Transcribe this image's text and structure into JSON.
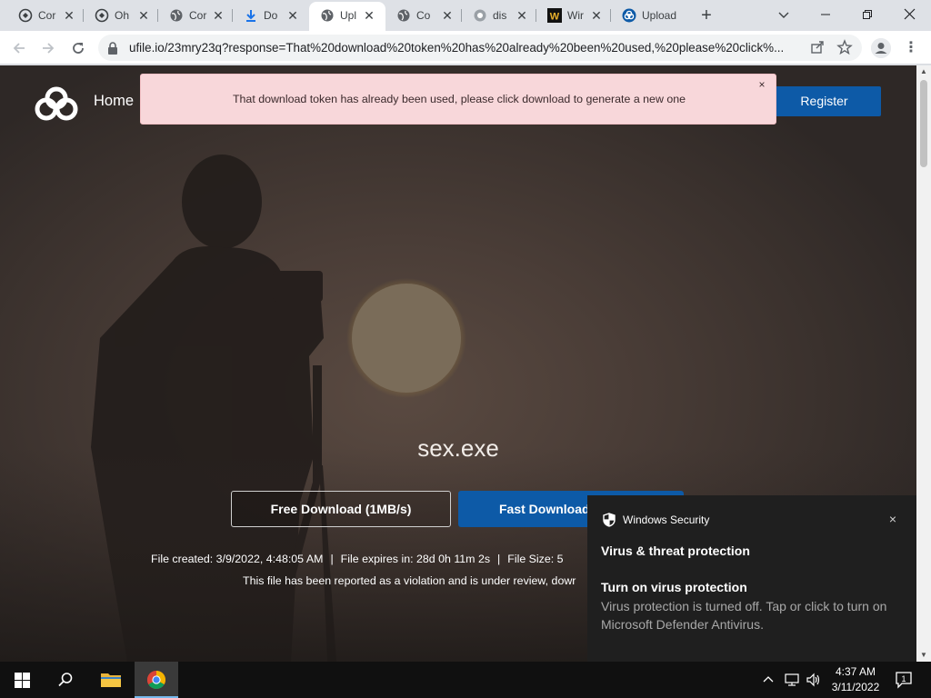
{
  "browser": {
    "tabs": [
      {
        "label": "Cor",
        "icon": "app-icon"
      },
      {
        "label": "Oh",
        "icon": "app-icon"
      },
      {
        "label": "Cor",
        "icon": "globe-icon"
      },
      {
        "label": "Do",
        "icon": "download-icon"
      },
      {
        "label": "Upl",
        "icon": "globe-icon",
        "active": true
      },
      {
        "label": "Co",
        "icon": "globe-icon"
      },
      {
        "label": "dis",
        "icon": "globe-icon"
      },
      {
        "label": "Wir",
        "icon": "w-logo-icon"
      },
      {
        "label": "Upload",
        "icon": "ufile-icon"
      }
    ],
    "new_tab": "+",
    "url": "ufile.io/23mry23q?response=That%20download%20token%20has%20already%20been%20used,%20please%20click%..."
  },
  "site": {
    "home_label": "Home",
    "register_label": "Register",
    "alert_message": "That download token has already been used, please click download to generate a new one",
    "alert_close": "×",
    "file_name": "sex.exe",
    "free_download_label": "Free Download (1MB/s)",
    "fast_download_label": "Fast Download",
    "file_created": "File created: 3/9/2022, 4:48:05 AM",
    "file_expires": "File expires in: 28d 0h 11m 2s",
    "file_size": "File Size: 5",
    "meta_separator": "|",
    "violation_notice": "This file has been reported as a violation and is under review, dowr"
  },
  "toast": {
    "app_name": "Windows Security",
    "title": "Virus & threat protection",
    "heading": "Turn on virus protection",
    "body": "Virus protection is turned off. Tap or click to turn on Microsoft Defender Antivirus.",
    "close": "×"
  },
  "taskbar": {
    "time": "4:37 AM",
    "date": "3/11/2022",
    "notification_count": "1"
  },
  "colors": {
    "accent_blue": "#0d5aa7",
    "alert_bg": "#f8d7da",
    "toast_bg": "#1f1f1f",
    "taskbar_bg": "#101010"
  }
}
